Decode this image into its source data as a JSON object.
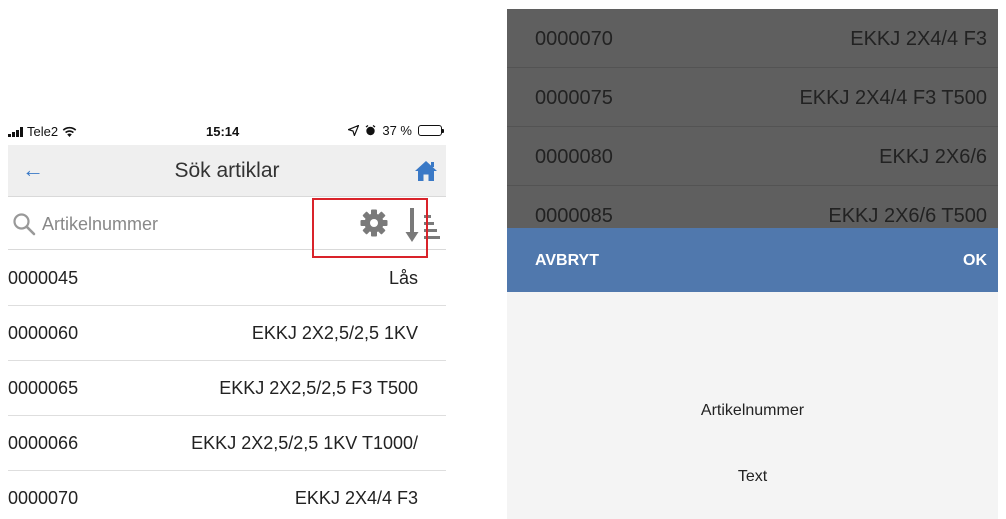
{
  "statusbar": {
    "carrier": "Tele2",
    "time": "15:14",
    "battery": "37 %",
    "battery_level": 0.37
  },
  "nav": {
    "title": "Sök artiklar",
    "back_icon": "arrow-left-icon",
    "home_icon": "home-icon"
  },
  "search": {
    "placeholder": "Artikelnummer",
    "value": ""
  },
  "articles": [
    {
      "number": "0000045",
      "text": "Lås"
    },
    {
      "number": "0000060",
      "text": "EKKJ 2X2,5/2,5 1KV"
    },
    {
      "number": "0000065",
      "text": "EKKJ 2X2,5/2,5 F3 T500"
    },
    {
      "number": "0000066",
      "text": "EKKJ 2X2,5/2,5 1KV T1000/"
    },
    {
      "number": "0000070",
      "text": "EKKJ 2X4/4 F3"
    }
  ],
  "background_list": [
    {
      "number": "0000070",
      "text": "EKKJ 2X4/4 F3"
    },
    {
      "number": "0000075",
      "text": "EKKJ 2X4/4 F3 T500"
    },
    {
      "number": "0000080",
      "text": "EKKJ 2X6/6"
    },
    {
      "number": "0000085",
      "text": "EKKJ 2X6/6 T500"
    }
  ],
  "picker": {
    "cancel_label": "AVBRYT",
    "ok_label": "OK",
    "options": [
      "Artikelnummer",
      "Text"
    ]
  },
  "colors": {
    "accent": "#3a79c6",
    "picker_bar": "#5078ad",
    "highlight": "#d9232a"
  }
}
